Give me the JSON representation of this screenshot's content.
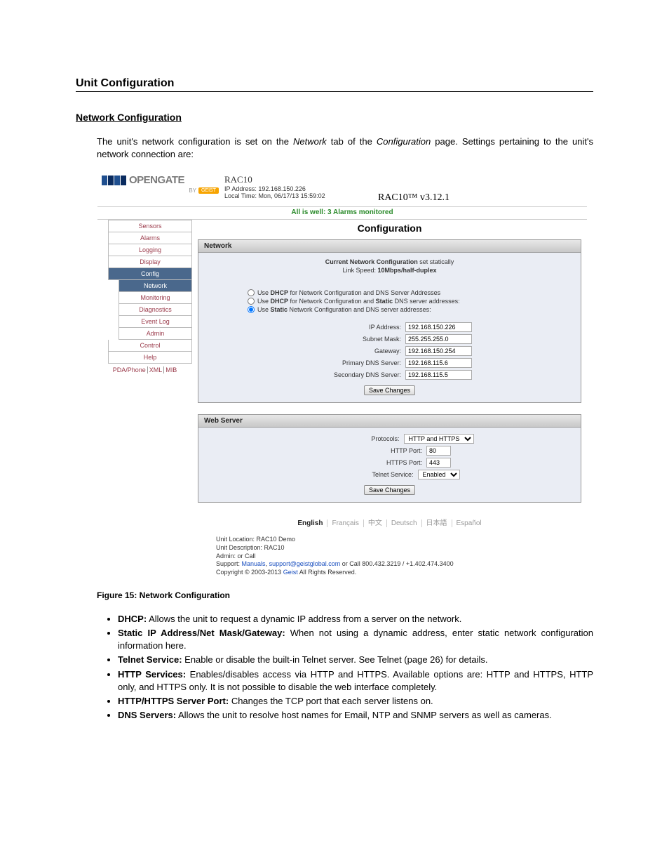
{
  "doc": {
    "section_title": "Unit Configuration",
    "subsection": "Network Configuration",
    "intro_pre": "The unit's network configuration is set on the ",
    "intro_tab": "Network",
    "intro_mid": " tab of the ",
    "intro_page": "Configuration",
    "intro_post": " page.  Settings pertaining to the unit's network connection are:",
    "figure_caption": "Figure 15: Network Configuration"
  },
  "screenshot": {
    "logo_text": "OPENGATE",
    "logo_by": "BY",
    "logo_brand": "GEIST",
    "device_name": "RAC10",
    "ip_label": "IP Address: ",
    "ip_value": "192.168.150.226",
    "time_label": "Local Time: ",
    "time_value": "Mon, 06/17/13 15:59:02",
    "version": "RAC10™ v3.12.1",
    "status": "All is well: 3 Alarms monitored",
    "config_title": "Configuration",
    "nav": {
      "sensors": "Sensors",
      "alarms": "Alarms",
      "logging": "Logging",
      "display": "Display",
      "config": "Config",
      "network": "Network",
      "monitoring": "Monitoring",
      "diagnostics": "Diagnostics",
      "eventlog": "Event Log",
      "admin": "Admin",
      "control": "Control",
      "help": "Help",
      "pda": "PDA/Phone",
      "xml": "XML",
      "mib": "MIB"
    },
    "network_panel": {
      "header": "Network",
      "current_pre": "Current Network Configuration ",
      "current_val": "set statically",
      "link_pre": "Link Speed: ",
      "link_val": "10Mbps/half-duplex",
      "opt_dhcp_all": "Use DHCP for Network Configuration and DNS Server Addresses",
      "opt_dhcp_static": "Use DHCP for Network Configuration and Static DNS server addresses:",
      "opt_static": "Use Static Network Configuration and DNS server addresses:",
      "dhcp_word": "DHCP",
      "static_word": "Static",
      "ip_addr_label": "IP Address:",
      "ip_addr_val": "192.168.150.226",
      "subnet_label": "Subnet Mask:",
      "subnet_val": "255.255.255.0",
      "gateway_label": "Gateway:",
      "gateway_val": "192.168.150.254",
      "dns1_label": "Primary DNS Server:",
      "dns1_val": "192.168.115.6",
      "dns2_label": "Secondary DNS Server:",
      "dns2_val": "192.168.115.5",
      "save_btn": "Save Changes"
    },
    "webserver_panel": {
      "header": "Web Server",
      "protocols_label": "Protocols:",
      "protocols_val": "HTTP and HTTPS",
      "http_port_label": "HTTP Port:",
      "http_port_val": "80",
      "https_port_label": "HTTPS Port:",
      "https_port_val": "443",
      "telnet_label": "Telnet Service:",
      "telnet_val": "Enabled",
      "save_btn": "Save Changes"
    },
    "langs": {
      "en": "English",
      "fr": "Français",
      "zh": "中文",
      "de": "Deutsch",
      "ja": "日本語",
      "es": "Español"
    },
    "footer": {
      "location": "Unit Location: RAC10 Demo",
      "description": "Unit Description: RAC10",
      "admin": "Admin: or Call",
      "support_pre": "Support: ",
      "support_manuals": "Manuals",
      "support_email": "support@geistglobal.com",
      "support_phone": " or Call 800.432.3219 / +1.402.474.3400",
      "copyright": "Copyright © 2003-2013 ",
      "copyright_link": "Geist",
      "copyright_post": " All Rights Reserved."
    }
  },
  "bullets": {
    "dhcp_h": "DHCP:",
    "dhcp_t": " Allows the unit to request a dynamic IP address from a server on the network.",
    "static_h": "Static IP Address/Net Mask/Gateway:",
    "static_t": " When not using a dynamic address, enter static network configuration information here.",
    "telnet_h": "Telnet Service:",
    "telnet_t": " Enable or disable the built-in Telnet server.  See Telnet (page 26) for details.",
    "http_h": "HTTP Services:",
    "http_t": " Enables/disables access via HTTP and HTTPS.  Available options are: HTTP and HTTPS, HTTP only, and HTTPS only.  It is not possible to disable the web interface completely.",
    "port_h": "HTTP/HTTPS Server Port:",
    "port_t": " Changes the TCP port that each server listens on.",
    "dns_h": "DNS Servers:",
    "dns_t": " Allows the unit to resolve host names for Email, NTP and SNMP servers as well as cameras."
  }
}
